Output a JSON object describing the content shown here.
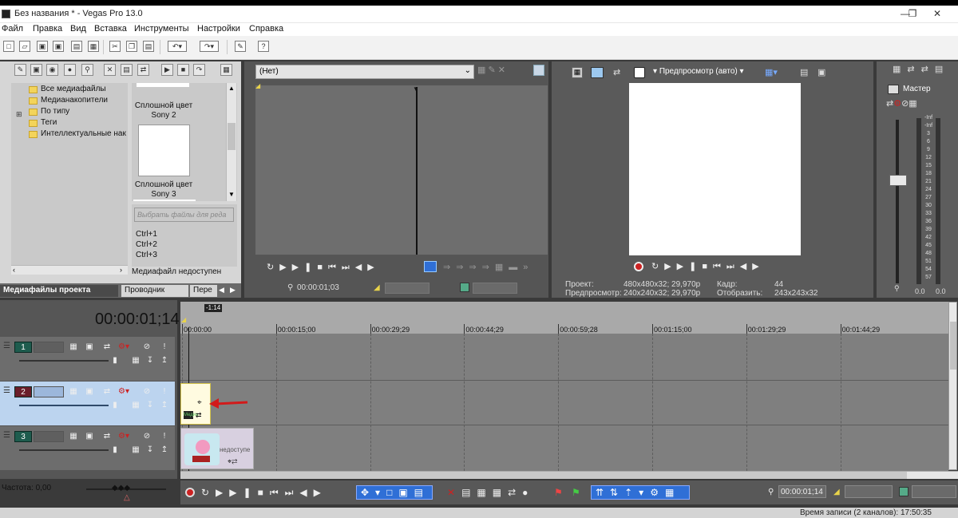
{
  "window": {
    "title": "Без названия * - Vegas Pro 13.0"
  },
  "menu": {
    "file": "Файл",
    "edit": "Правка",
    "view": "Вид",
    "insert": "Вставка",
    "tools": "Инструменты",
    "settings": "Настройки",
    "help": "Справка"
  },
  "media": {
    "tree": [
      "Все медиафайлы",
      "Медианакопители",
      "По типу",
      "Теги",
      "Интеллектуальные нак"
    ],
    "thumb1_caption": [
      "Сплошной цвет",
      "Sony 2"
    ],
    "thumb2_caption": [
      "Сплошной цвет",
      "Sony 3"
    ],
    "search_placeholder": "Выбрать файлы для реда",
    "shortcuts": [
      "Ctrl+1",
      "Ctrl+2",
      "Ctrl+3"
    ],
    "unavailable": "Медиафайл недоступен",
    "tabs": [
      "Медиафайлы проекта",
      "Проводник",
      "Пере"
    ]
  },
  "trimmer": {
    "source": "(Нет)",
    "timecode": "00:00:01;03"
  },
  "preview": {
    "mode": "Предпросмотр (авто)",
    "project_label": "Проект:",
    "project_value": "480x480x32; 29,970p",
    "preview_label": "Предпросмотр:",
    "preview_value": "240x240x32; 29,970p",
    "frame_label": "Кадр:",
    "frame_value": "44",
    "display_label": "Отобразить:",
    "display_value": "243x243x32"
  },
  "master": {
    "label": "Мастер",
    "scale": [
      "-Inf",
      "-Inf",
      "3",
      "6",
      "9",
      "12",
      "15",
      "18",
      "21",
      "24",
      "27",
      "30",
      "33",
      "36",
      "39",
      "42",
      "45",
      "48",
      "51",
      "54",
      "57"
    ],
    "bottom_values": [
      "0.0",
      "0.0"
    ]
  },
  "timeline": {
    "current_time": "00:00:01;14",
    "marker": "-1:14",
    "ruler": [
      "00:00:00",
      "00:00:15;00",
      "00:00:29;29",
      "00:00:44;29",
      "00:00:59;28",
      "00:01:15;00",
      "00:01:29;29",
      "00:01:44;29"
    ],
    "tracks": [
      "1",
      "2",
      "3"
    ],
    "clip3_label": "недоступе",
    "clip_media_badge": "Медиа"
  },
  "bottom": {
    "rate_label": "Частота: 0,00",
    "timecode": "00:00:01;14"
  },
  "status": {
    "record_time": "Время записи (2 каналов): 17:50:35"
  },
  "colors": {
    "track_selected": "#bcd4ef",
    "track_video": "#1e5c4e",
    "record": "#cc2222",
    "accent_blue": "#2f6fd6"
  }
}
